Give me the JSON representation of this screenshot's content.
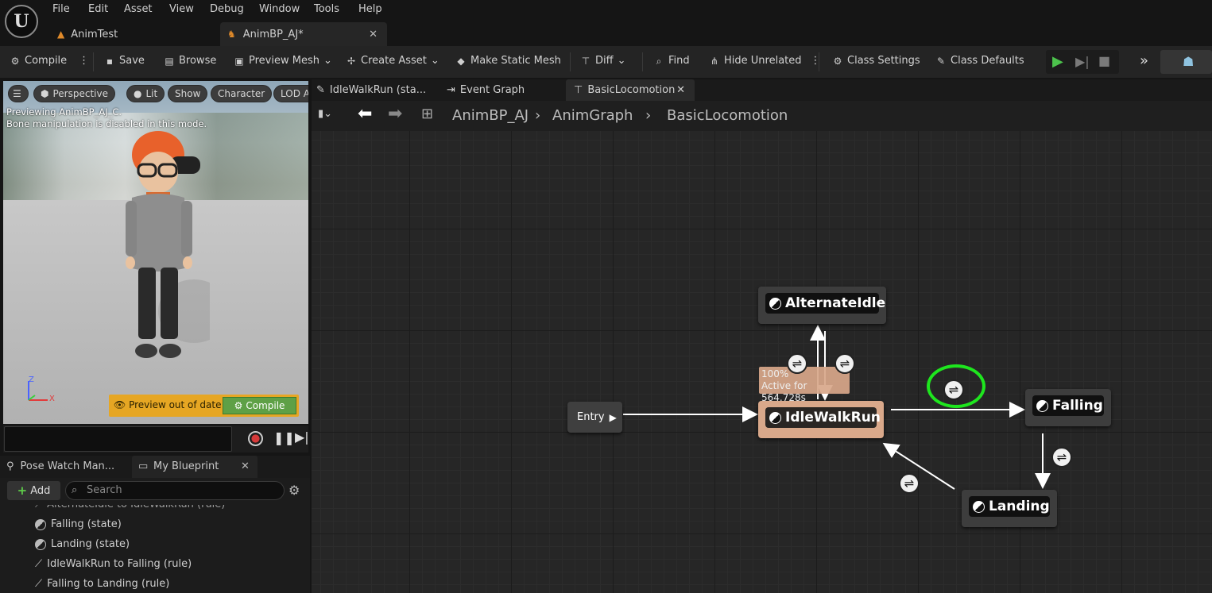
{
  "menu": [
    "File",
    "Edit",
    "Asset",
    "View",
    "Debug",
    "Window",
    "Tools",
    "Help"
  ],
  "doc_tabs": [
    {
      "label": "AnimTest",
      "active": false
    },
    {
      "label": "AnimBP_AJ*",
      "active": true
    }
  ],
  "toolbar": {
    "compile": "Compile",
    "save": "Save",
    "browse": "Browse",
    "preview_mesh": "Preview Mesh",
    "create_asset": "Create Asset",
    "make_static_mesh": "Make Static Mesh",
    "diff": "Diff",
    "find": "Find",
    "hide_unrelated": "Hide Unrelated",
    "class_settings": "Class Settings",
    "class_defaults": "Class Defaults"
  },
  "viewport": {
    "perspective": "Perspective",
    "lit": "Lit",
    "show": "Show",
    "character": "Character",
    "lod": "LOD A",
    "msg1": "Previewing AnimBP_AJ_C.",
    "msg2": "Bone manipulation is disabled in this mode.",
    "preview_out_of_date": "Preview out of date",
    "compile": "Compile",
    "axis_z": "Z",
    "axis_x": "X"
  },
  "lower_tabs": {
    "pose_watch": "Pose Watch Man...",
    "my_blueprint": "My Blueprint"
  },
  "my_blueprint": {
    "add": "Add",
    "search_placeholder": "Search",
    "items": [
      {
        "label": "AlternateIdle to IdleWalkRun (rule)",
        "icon": "rule-icon"
      },
      {
        "label": "Falling (state)",
        "icon": "state-icon"
      },
      {
        "label": "Landing (state)",
        "icon": "state-icon"
      },
      {
        "label": "IdleWalkRun to Falling (rule)",
        "icon": "rule-icon"
      },
      {
        "label": "Falling to Landing (rule)",
        "icon": "rule-icon"
      }
    ]
  },
  "graph_tabs": [
    {
      "label": "IdleWalkRun (sta...",
      "active": false
    },
    {
      "label": "Event Graph",
      "active": false
    },
    {
      "label": "BasicLocomotion",
      "active": true
    }
  ],
  "breadcrumb": [
    "AnimBP_AJ",
    "AnimGraph",
    "BasicLocomotion"
  ],
  "graph": {
    "entry": "Entry",
    "states": {
      "alternate_idle": "AlternateIdle",
      "idle_walk_run": "IdleWalkRun",
      "falling": "Falling",
      "landing": "Landing"
    },
    "active_pct": "100%",
    "active_time": "Active for 564.728s"
  },
  "colors": {
    "active_state": "#d9a88a",
    "highlight": "#1ee61e",
    "compile_green": "#5ea046",
    "warning": "#e6a623"
  }
}
